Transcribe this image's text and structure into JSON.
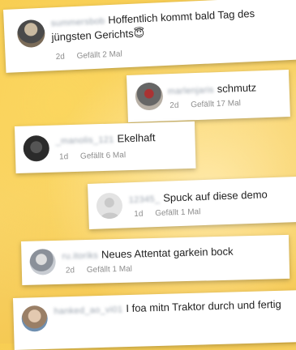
{
  "comments": [
    {
      "username": "summersbob",
      "text": "Hoffentlich kommt bald Tag des jüngsten Gerichts",
      "emoji": "😇",
      "age": "2d",
      "likes": "Gefällt 2 Mal"
    },
    {
      "username": "marlenjaris",
      "text": "schmutz",
      "age": "2d",
      "likes": "Gefällt 17 Mal"
    },
    {
      "username": "_manolis_121",
      "text": "Ekelhaft",
      "age": "1d",
      "likes": "Gefällt 6 Mal"
    },
    {
      "username": "12345_",
      "text": "Spuck auf diese demo",
      "age": "1d",
      "likes": "Gefällt 1 Mal"
    },
    {
      "username": "ru.itoriks",
      "text": "Neues Attentat garkein bock",
      "age": "2d",
      "likes": "Gefällt 1 Mal"
    },
    {
      "username": "hanked_ao_vi01",
      "text": "I foa mitn Traktor durch und fertig",
      "age": "",
      "likes": ""
    }
  ]
}
